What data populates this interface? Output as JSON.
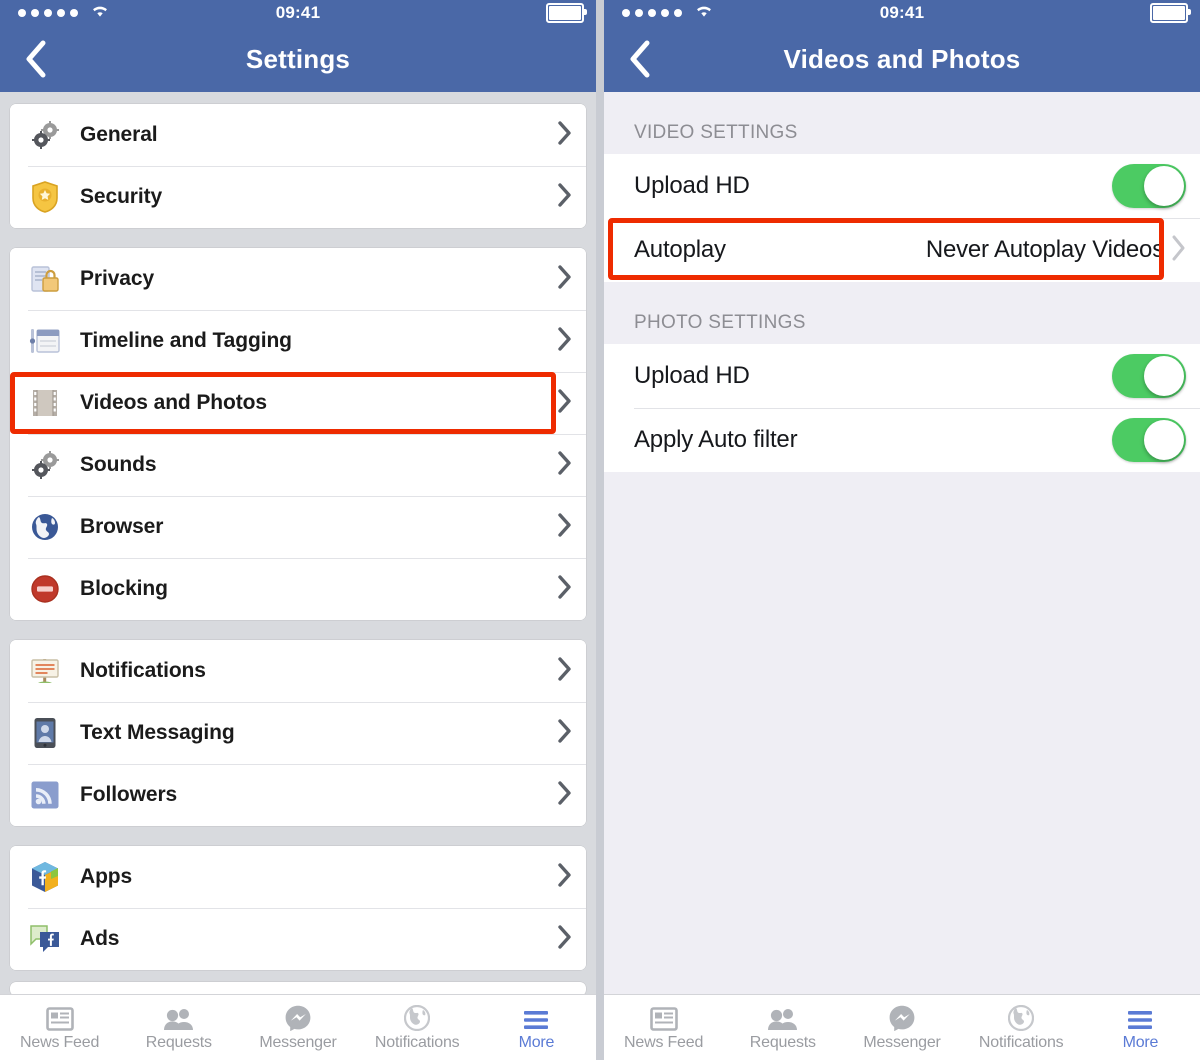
{
  "colors": {
    "nav_blue": "#4a68a7",
    "highlight_red": "#ee2b00",
    "toggle_green": "#4ccb63",
    "tab_active_blue": "#5b7bd5",
    "left_bg": "#d8dade",
    "right_bg": "#efeef4"
  },
  "left": {
    "statusbar": {
      "time": "09:41",
      "signal_dots": 5,
      "wifi": "wifi-icon",
      "battery": "battery-full-icon"
    },
    "nav": {
      "back": "back-chevron-icon",
      "title": "Settings"
    },
    "groups": [
      {
        "rows": [
          {
            "label": "General",
            "icon": "gears-icon"
          },
          {
            "label": "Security",
            "icon": "shield-badge-icon"
          }
        ]
      },
      {
        "rows": [
          {
            "label": "Privacy",
            "icon": "lock-document-icon"
          },
          {
            "label": "Timeline and Tagging",
            "icon": "timeline-icon"
          },
          {
            "label": "Videos and Photos",
            "icon": "film-strip-icon",
            "highlighted": true
          },
          {
            "label": "Sounds",
            "icon": "gears-icon"
          },
          {
            "label": "Browser",
            "icon": "globe-icon"
          },
          {
            "label": "Blocking",
            "icon": "no-entry-icon"
          }
        ]
      },
      {
        "rows": [
          {
            "label": "Notifications",
            "icon": "signboard-icon"
          },
          {
            "label": "Text Messaging",
            "icon": "phone-person-icon"
          },
          {
            "label": "Followers",
            "icon": "rss-icon"
          }
        ]
      },
      {
        "rows": [
          {
            "label": "Apps",
            "icon": "app-cube-icon"
          },
          {
            "label": "Ads",
            "icon": "ads-speech-icon"
          }
        ]
      }
    ]
  },
  "right": {
    "statusbar": {
      "time": "09:41",
      "signal_dots": 5,
      "wifi": "wifi-icon",
      "battery": "battery-full-icon"
    },
    "nav": {
      "back": "back-chevron-icon",
      "title": "Videos and Photos"
    },
    "sections": [
      {
        "header": "VIDEO SETTINGS",
        "rows": [
          {
            "label": "Upload HD",
            "type": "toggle",
            "value": "on"
          },
          {
            "label": "Autoplay",
            "type": "disclosure",
            "value": "Never Autoplay Videos",
            "highlighted": true
          }
        ]
      },
      {
        "header": "PHOTO SETTINGS",
        "rows": [
          {
            "label": "Upload HD",
            "type": "toggle",
            "value": "on"
          },
          {
            "label": "Apply Auto filter",
            "type": "toggle",
            "value": "on"
          }
        ]
      }
    ]
  },
  "tabbar": [
    {
      "label": "News Feed",
      "icon": "news-feed-icon",
      "active": false
    },
    {
      "label": "Requests",
      "icon": "friend-requests-icon",
      "active": false
    },
    {
      "label": "Messenger",
      "icon": "messenger-icon",
      "active": false
    },
    {
      "label": "Notifications",
      "icon": "globe-notifications-icon",
      "active": false
    },
    {
      "label": "More",
      "icon": "hamburger-more-icon",
      "active": true
    }
  ]
}
